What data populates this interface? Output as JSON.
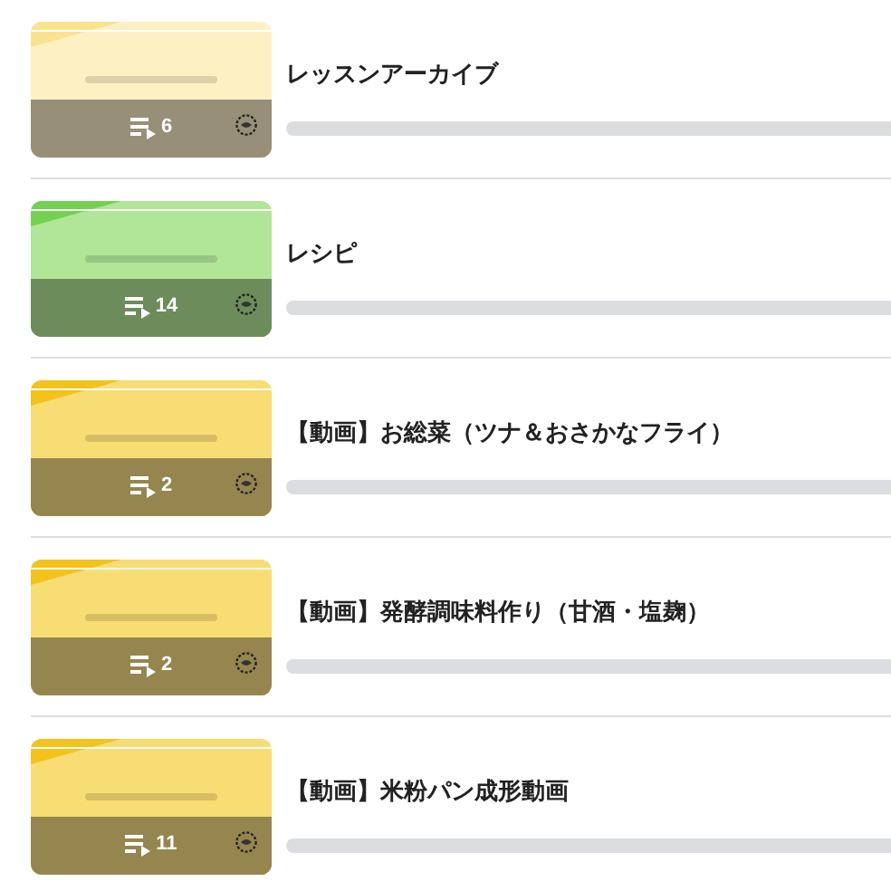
{
  "items": [
    {
      "title": "レッスンアーカイブ",
      "count": "6",
      "level": 0
    },
    {
      "title": "レシピ",
      "count": "14",
      "level": 0
    },
    {
      "title": "【動画】お総菜（ツナ＆おさかなフライ）",
      "count": "2",
      "level": 0
    },
    {
      "title": "【動画】発酵調味料作り（甘酒・塩麹）",
      "count": "2",
      "level": 0
    },
    {
      "title": "【動画】米粉パン成形動画",
      "count": "11",
      "level": 0
    }
  ]
}
